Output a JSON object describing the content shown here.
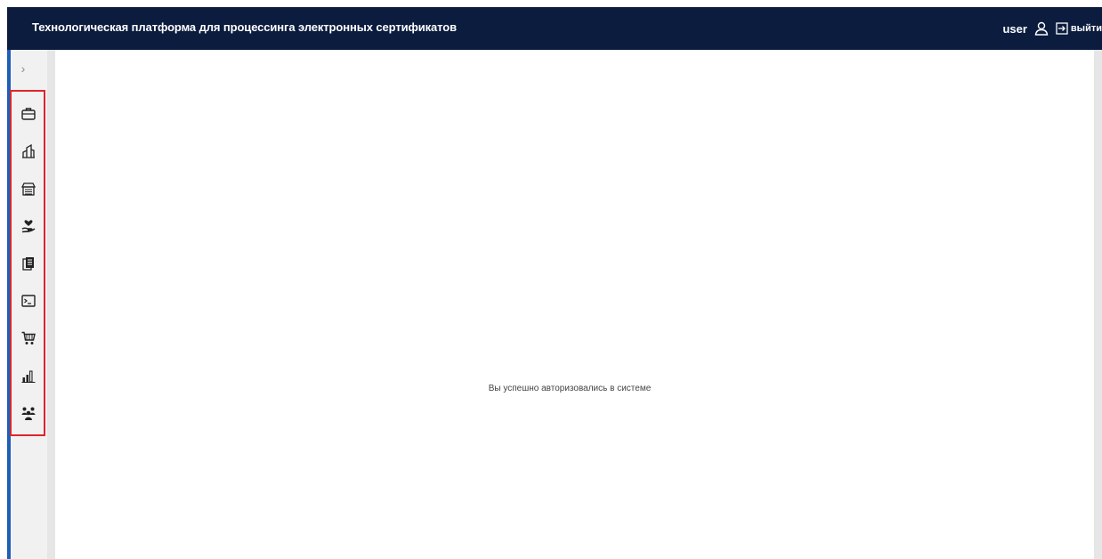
{
  "header": {
    "title": "Технологическая платформа для процессинга электронных сертификатов",
    "username": "user",
    "logout_label": "выйти",
    "background_color": "#0b1c3f"
  },
  "sidebar": {
    "toggle_glyph": "›",
    "items": [
      {
        "icon": "briefcase-icon"
      },
      {
        "icon": "building-icon"
      },
      {
        "icon": "storefront-icon"
      },
      {
        "icon": "heart-hand-icon"
      },
      {
        "icon": "documents-icon"
      },
      {
        "icon": "terminal-icon"
      },
      {
        "icon": "shopping-cart-icon"
      },
      {
        "icon": "bar-chart-icon"
      },
      {
        "icon": "users-group-icon"
      }
    ],
    "highlight_color": "#e0242a"
  },
  "main": {
    "message": "Вы успешно авторизовались в системе"
  }
}
